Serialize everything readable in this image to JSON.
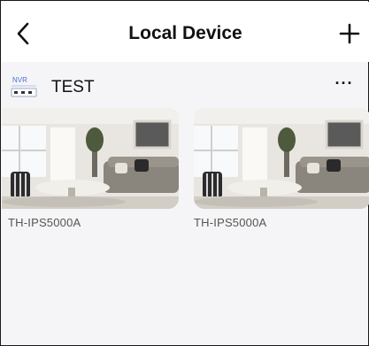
{
  "header": {
    "back_icon": "chevron-left-icon",
    "title": "Local Device",
    "add_icon": "plus-icon"
  },
  "device": {
    "icon": "nvr-icon",
    "icon_text": "NVR",
    "name": "TEST",
    "more_label": "···"
  },
  "channels": [
    {
      "label": "TH-IPS5000A"
    },
    {
      "label": "TH-IPS5000A"
    }
  ]
}
